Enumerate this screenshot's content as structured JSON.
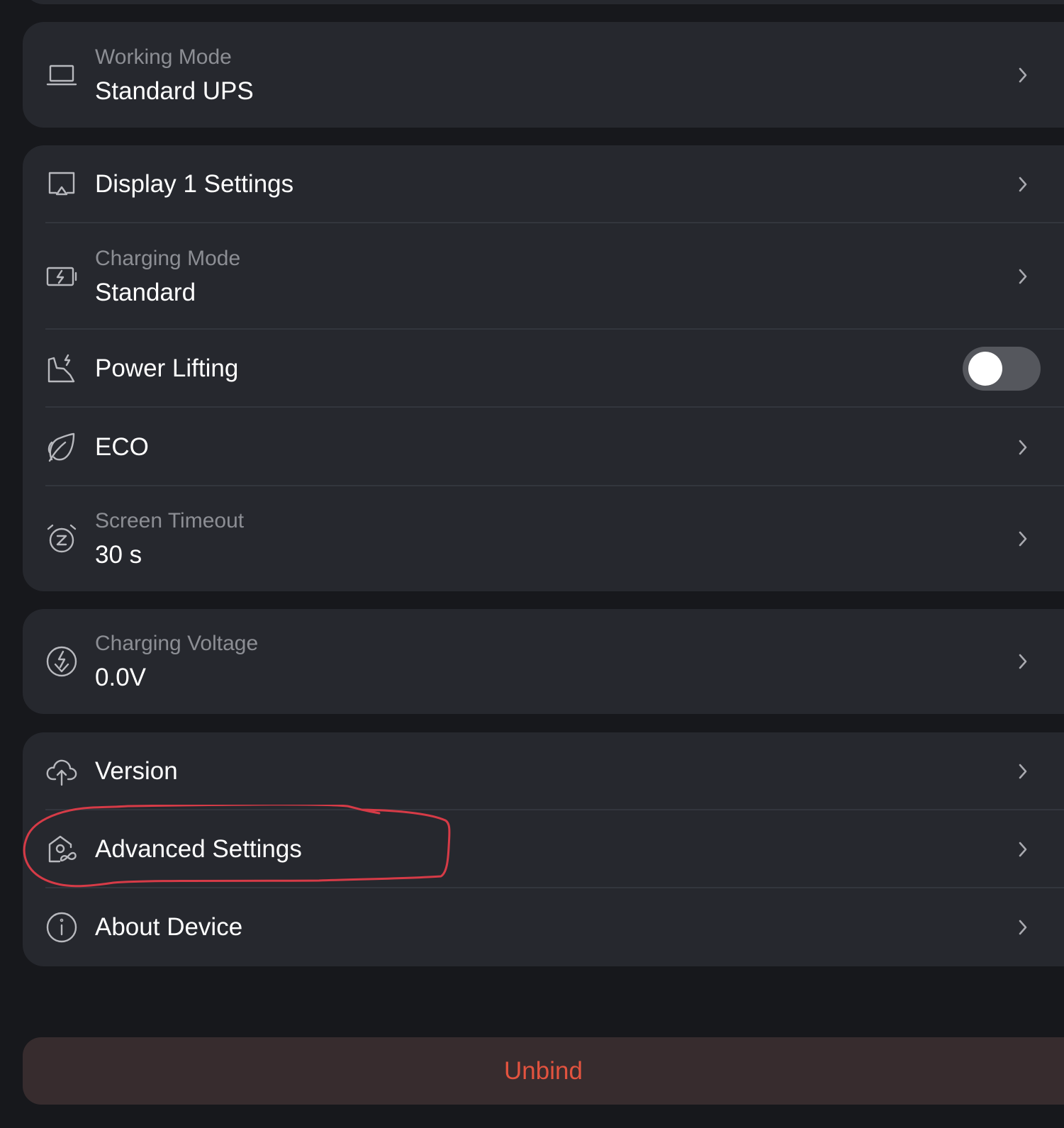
{
  "settings": {
    "working_mode": {
      "sublabel": "Working Mode",
      "value": "Standard UPS",
      "icon": "laptop-icon"
    },
    "display_settings": {
      "label": "Display 1 Settings",
      "icon": "display-icon"
    },
    "charging_mode": {
      "sublabel": "Charging Mode",
      "value": "Standard",
      "icon": "battery-charging-icon"
    },
    "power_lifting": {
      "label": "Power Lifting",
      "icon": "power-lifting-icon",
      "toggle_on": false
    },
    "eco": {
      "label": "ECO",
      "icon": "leaf-icon"
    },
    "screen_timeout": {
      "sublabel": "Screen Timeout",
      "value": "30 s",
      "icon": "alarm-clock-icon"
    },
    "charging_voltage": {
      "sublabel": "Charging Voltage",
      "value": "0.0V",
      "icon": "voltage-icon"
    },
    "version": {
      "label": "Version",
      "icon": "cloud-upload-icon"
    },
    "advanced_settings": {
      "label": "Advanced Settings",
      "icon": "advanced-settings-icon"
    },
    "about_device": {
      "label": "About Device",
      "icon": "info-icon"
    }
  },
  "unbind": {
    "label": "Unbind"
  },
  "colors": {
    "background": "#17181c",
    "card": "#26282e",
    "unbind_bg": "#372c2e",
    "unbind_text": "#e3533f",
    "annotation": "#d63b47"
  }
}
